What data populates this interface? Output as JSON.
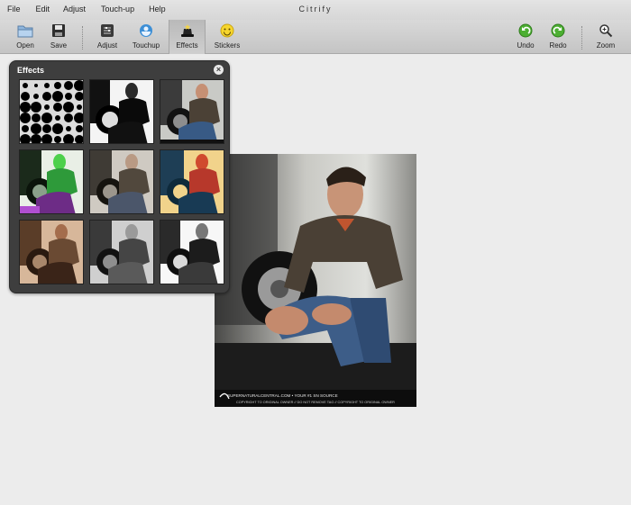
{
  "app": {
    "title": "Citrify"
  },
  "menu": [
    "File",
    "Edit",
    "Adjust",
    "Touch-up",
    "Help"
  ],
  "toolbar": {
    "open": "Open",
    "save": "Save",
    "adjust": "Adjust",
    "touchup": "Touchup",
    "effects": "Effects",
    "stickers": "Stickers",
    "undo": "Undo",
    "redo": "Redo",
    "zoom": "Zoom"
  },
  "effects_panel": {
    "title": "Effects",
    "close_icon": "close-icon"
  },
  "photo": {
    "watermark_line1": "SUPERNATURALCENTRAL.COM • YOUR #1 SN SOURCE",
    "watermark_line2": "COPYRIGHT TO ORIGINAL OWNER // DO NOT REMOVE TAG // COPYRIGHT TO ORIGINAL OWNER"
  },
  "colors": {
    "accent_green": "#4caf32",
    "panel_bg": "#3e3e3e",
    "toolbar_bg": "#cfcfcf"
  }
}
